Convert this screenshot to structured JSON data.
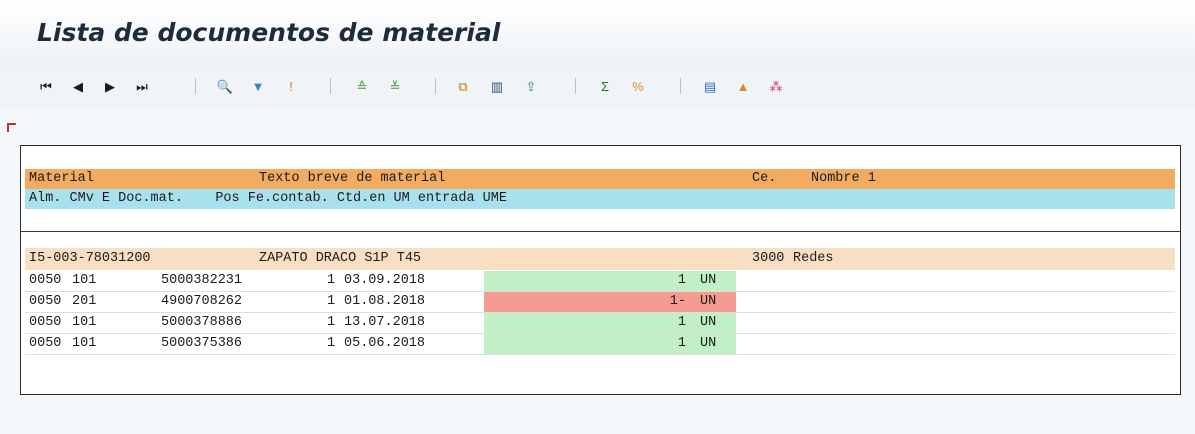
{
  "window": {
    "title": "Lista de documentos de material"
  },
  "toolbar": {
    "buttons": [
      {
        "name": "first-page-button",
        "icon": "first-page-icon",
        "glyph": "⏮",
        "color": "#1b1b1b"
      },
      {
        "name": "previous-page-button",
        "icon": "previous-page-icon",
        "glyph": "◀",
        "color": "#1b1b1b"
      },
      {
        "name": "next-page-button",
        "icon": "next-page-icon",
        "glyph": "▶",
        "color": "#1b1b1b"
      },
      {
        "name": "last-page-button",
        "icon": "last-page-icon",
        "glyph": "⏭",
        "color": "#1b1b1b"
      },
      {
        "name": "find-button",
        "icon": "find-icon",
        "glyph": "🔍",
        "color": "#2f6fb2"
      },
      {
        "name": "filter-button",
        "icon": "filter-icon",
        "glyph": "▼",
        "color": "#3b7fd1"
      },
      {
        "name": "exception-button",
        "icon": "exception-icon",
        "glyph": "!",
        "color": "#b58a00"
      },
      {
        "name": "sort-ascending-button",
        "icon": "sort-ascending-icon",
        "glyph": "≙",
        "color": "#3a9c3a"
      },
      {
        "name": "sort-descending-button",
        "icon": "sort-descending-icon",
        "glyph": "≚",
        "color": "#3a9c3a"
      },
      {
        "name": "copy-button",
        "icon": "copy-icon",
        "glyph": "⧉",
        "color": "#c07a00"
      },
      {
        "name": "columns-button",
        "icon": "columns-icon",
        "glyph": "▥",
        "color": "#2d4e7a"
      },
      {
        "name": "export-button",
        "icon": "export-icon",
        "glyph": "⇪",
        "color": "#2f8a6a"
      },
      {
        "name": "sum-button",
        "icon": "sum-icon",
        "glyph": "Σ",
        "color": "#1e7a2e"
      },
      {
        "name": "subtotal-button",
        "icon": "subtotal-icon",
        "glyph": "%",
        "color": "#d9893a"
      },
      {
        "name": "layout-button",
        "icon": "layout-icon",
        "glyph": "▤",
        "color": "#2d6fc4"
      },
      {
        "name": "chart-button",
        "icon": "chart-icon",
        "glyph": "▲",
        "color": "#d88b2a"
      },
      {
        "name": "abc-analysis-button",
        "icon": "abc-analysis-icon",
        "glyph": "⁂",
        "color": "#c03a6a"
      }
    ]
  },
  "report": {
    "header1": {
      "material": "Material",
      "text": "Texto breve de material",
      "plant": "Ce.",
      "name": "Nombre 1"
    },
    "header2": {
      "columns": "Alm. CMv E Doc.mat.    Pos Fe.contab. Ctd.en UM entrada UME"
    },
    "material_row": {
      "material": "I5-003-78031200",
      "text": "ZAPATO DRACO S1P T45",
      "plant": "3000",
      "name": "Redes"
    },
    "items": [
      {
        "storage": "0050",
        "movement": "101",
        "doc": "5000382231",
        "pos": "1",
        "date": "03.09.2018",
        "qty": "1",
        "uom": "UN",
        "color": "#c1f0c6"
      },
      {
        "storage": "0050",
        "movement": "201",
        "doc": "4900708262",
        "pos": "1",
        "date": "01.08.2018",
        "qty": "1-",
        "uom": "UN",
        "color": "#f59b91"
      },
      {
        "storage": "0050",
        "movement": "101",
        "doc": "5000378886",
        "pos": "1",
        "date": "13.07.2018",
        "qty": "1",
        "uom": "UN",
        "color": "#c1f0c6"
      },
      {
        "storage": "0050",
        "movement": "101",
        "doc": "5000375386",
        "pos": "1",
        "date": "05.06.2018",
        "qty": "1",
        "uom": "UN",
        "color": "#c1f0c6"
      }
    ]
  }
}
